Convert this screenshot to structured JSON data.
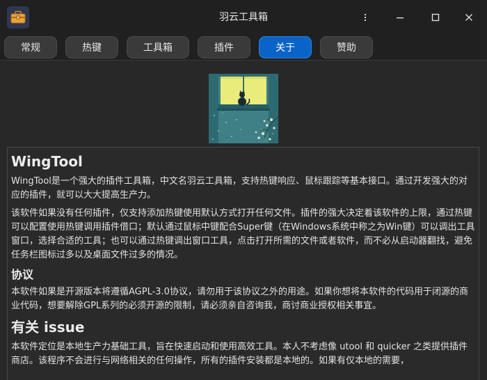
{
  "window": {
    "title": "羽云工具箱",
    "app_icon": "toolbox-icon",
    "controls": [
      "minimize-icon",
      "maximize-icon",
      "close-icon"
    ]
  },
  "tabs": [
    {
      "label": "常规",
      "active": false
    },
    {
      "label": "热键",
      "active": false
    },
    {
      "label": "工具箱",
      "active": false
    },
    {
      "label": "插件",
      "active": false
    },
    {
      "label": "关于",
      "active": true
    },
    {
      "label": "赞助",
      "active": false
    }
  ],
  "accent_color": "#0a64c8",
  "about": {
    "cover_image": "window-cat-illustration",
    "heading": "WingTool",
    "intro": "WingTool是一个强大的插件工具箱，中文名羽云工具箱，支持热键响应、鼠标跟踪等基本接口。通过开发强大的对应的插件，就可以大大提高生产力。",
    "detail": "该软件如果没有任何插件，仅支持添加热键使用默认方式打开任何文件。插件的强大决定着该软件的上限，通过热键可以配置使用热键调用插件借口；默认通过鼠标中键配合Super键（在Windows系统中称之为Win键）可以调出工具窗口，选择合适的工具；也可以通过热键调出窗口工具，点击打开所需的文件或者软件，而不必从启动器翻找，避免任务栏图标过多以及桌面文件过多的情况。",
    "license_heading": "协议",
    "license_text": "本软件如果是开源版本将遵循AGPL-3.0协议，请勿用于该协议之外的用途。如果你想将本软件的代码用于闭源的商业代码，想要解除GPL系列的必须开源的限制，请必须亲自咨询我，商讨商业授权相关事宜。",
    "issue_heading": "有关 issue",
    "issue_text": "本软件定位是本地生产力基础工具，旨在快速启动和使用高效工具。本人不考虑像 utool 和 quicker 之类提供插件商店。该程序不会进行与网络相关的任何操作，所有的插件安装都是本地的。如果有仅本地的需要，"
  }
}
